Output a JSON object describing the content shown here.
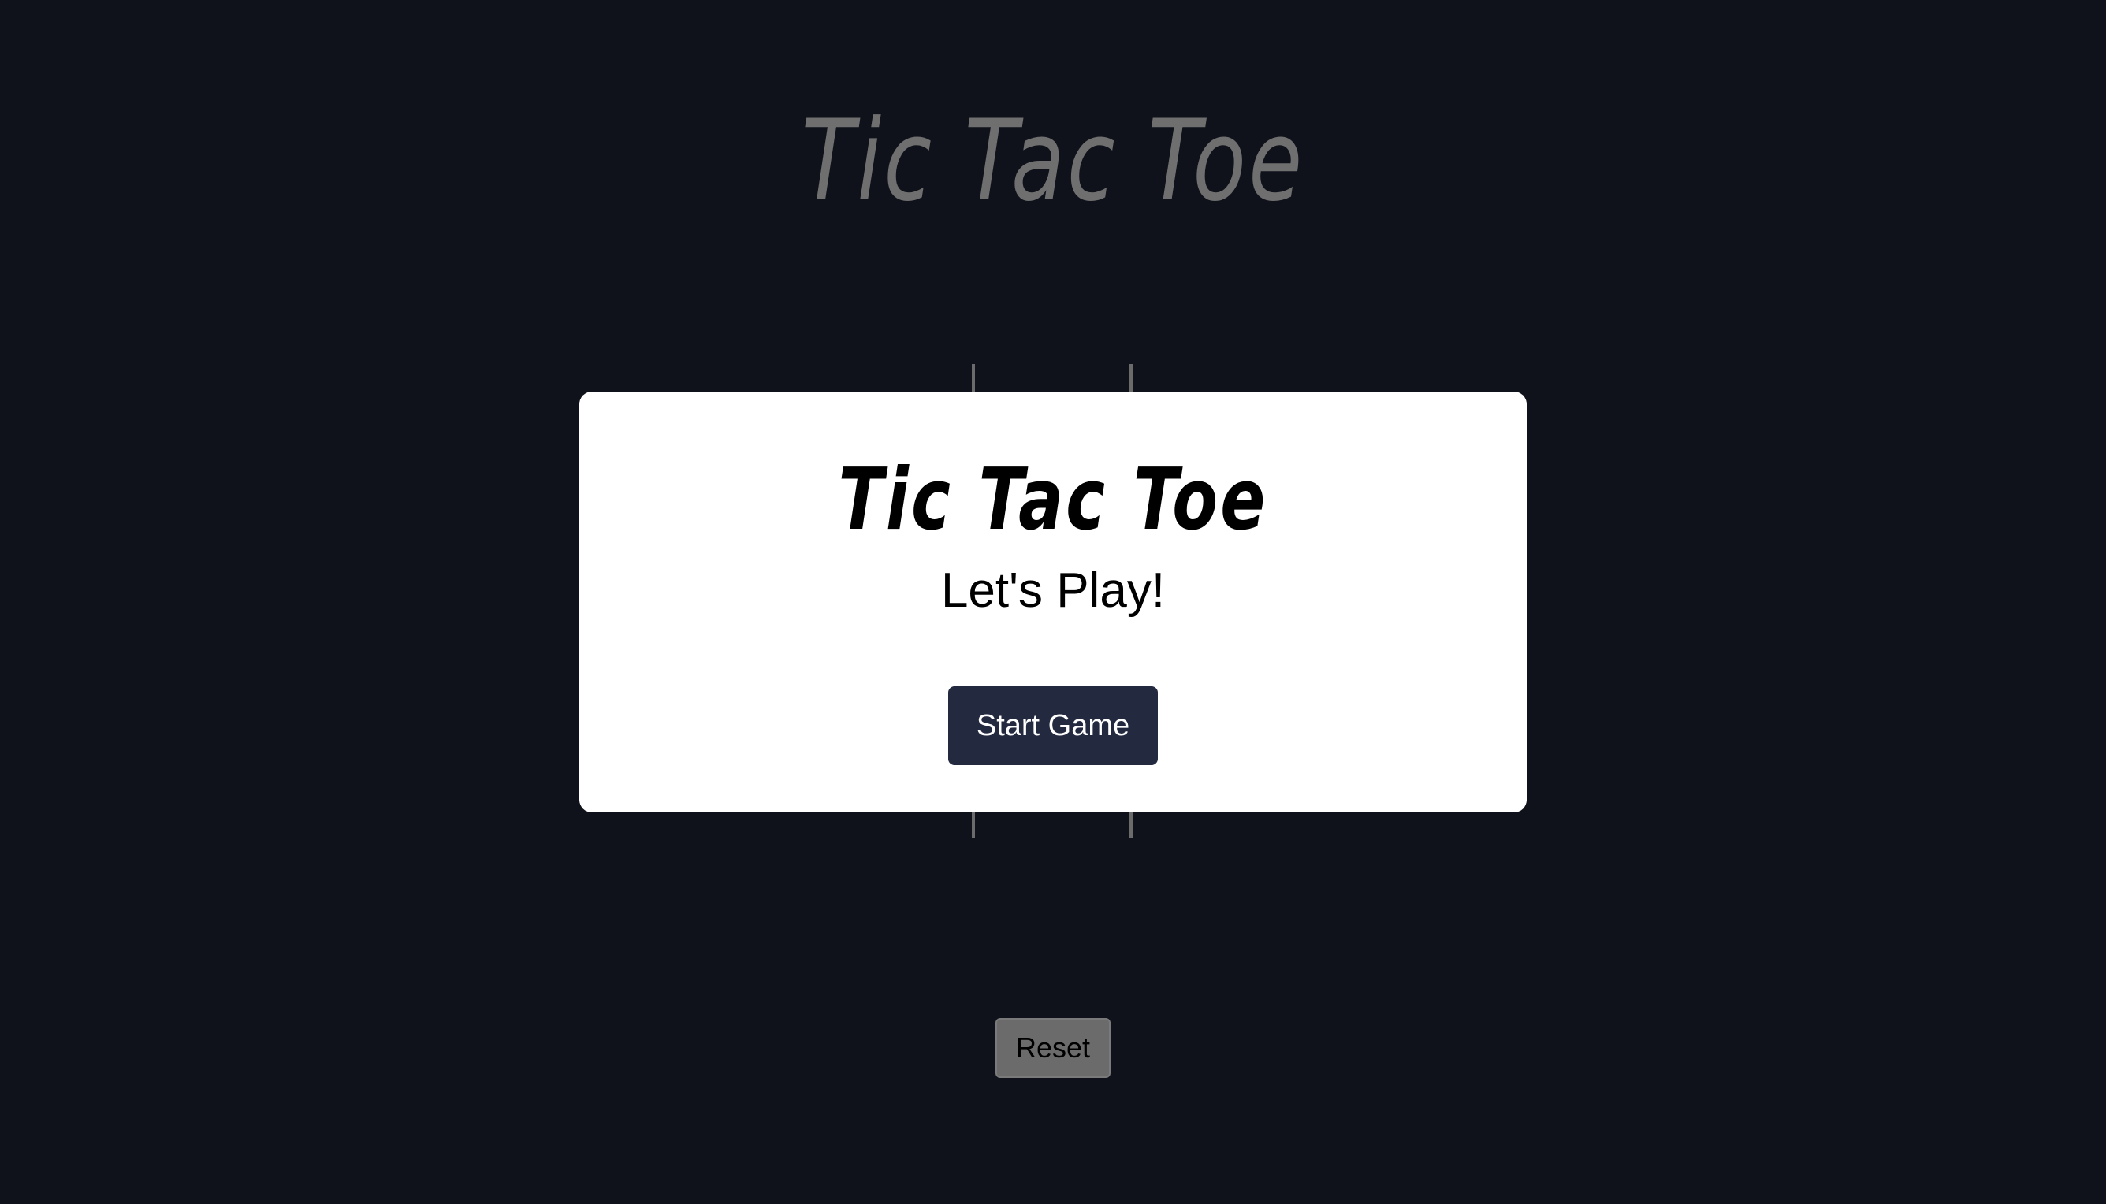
{
  "page": {
    "title": "Tic Tac Toe"
  },
  "modal": {
    "title": "Tic Tac Toe",
    "subtitle": "Let's Play!",
    "start_label": "Start Game"
  },
  "controls": {
    "reset_label": "Reset"
  },
  "colors": {
    "background": "#0f121a",
    "title_muted": "#6f6f6f",
    "grid_line": "#6b6b6b",
    "modal_bg": "#ffffff",
    "start_button_bg": "#232a40",
    "reset_button_bg": "#6b6b6b"
  }
}
